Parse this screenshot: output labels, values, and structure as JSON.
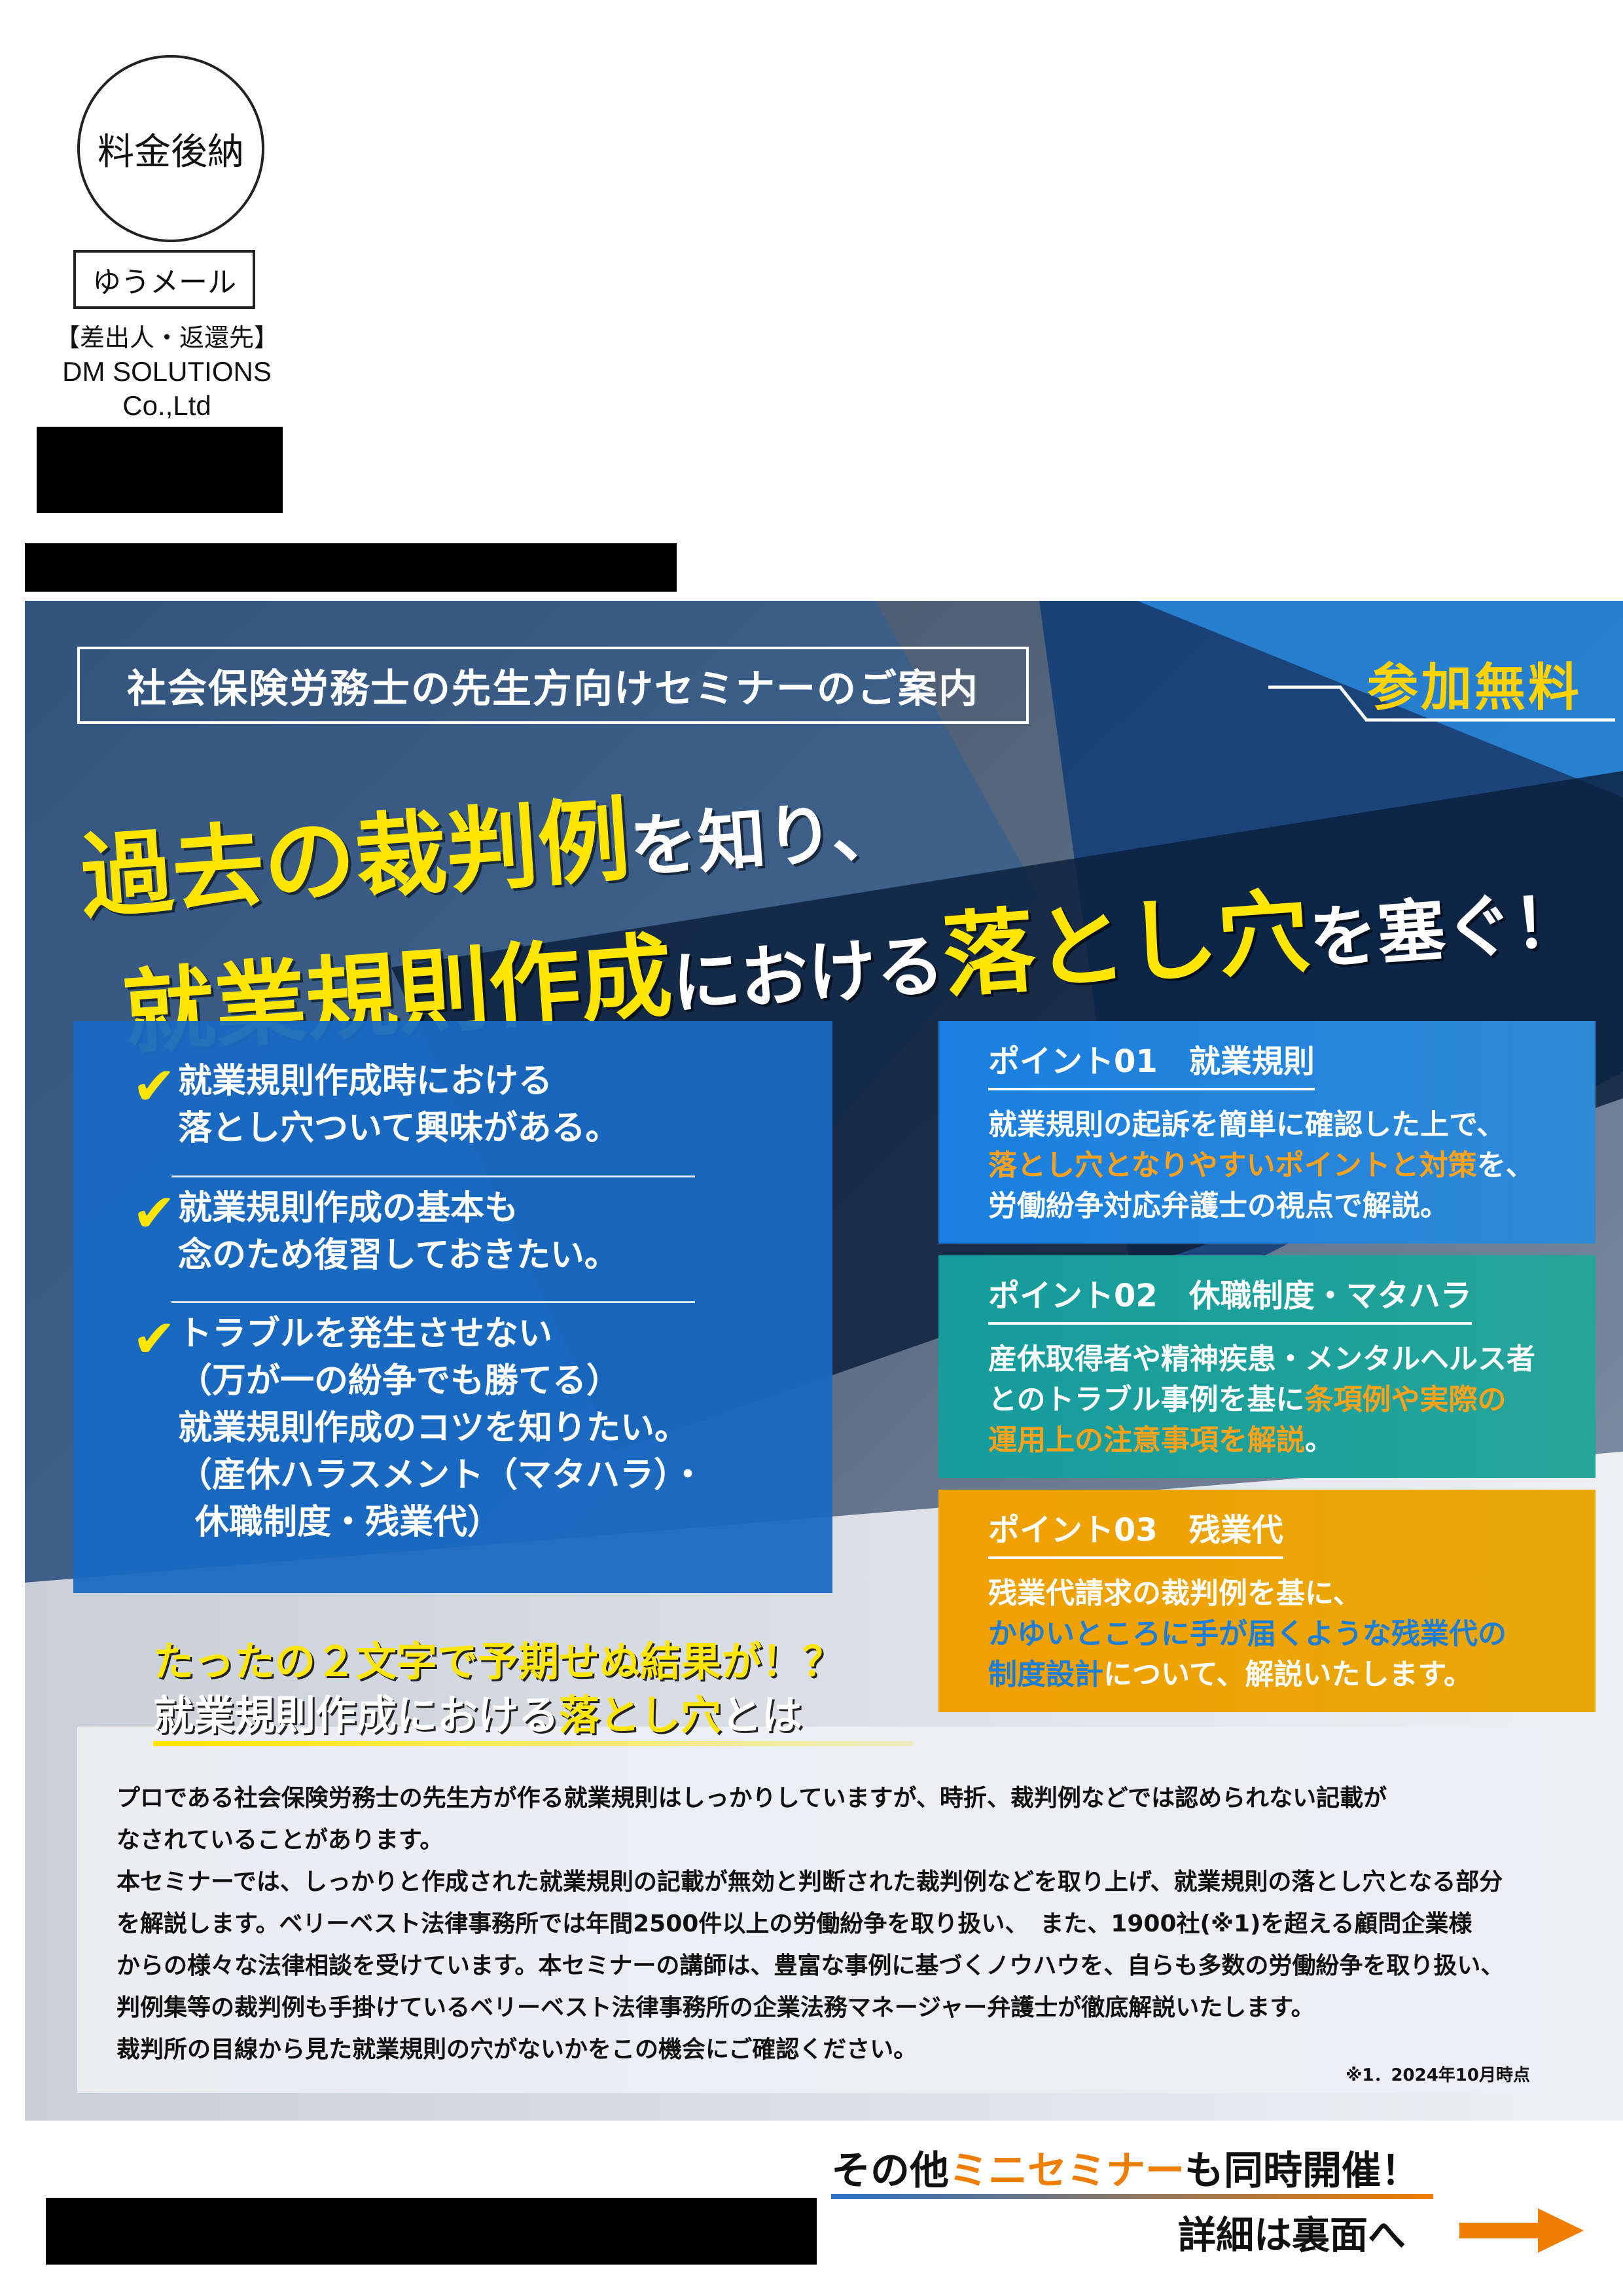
{
  "postage": {
    "stamp": "料金後納",
    "service": "ゆうメール"
  },
  "sender": {
    "label": "【差出人・返還先】",
    "company_line1": "DM SOLUTIONS",
    "company_line2": "Co.,Ltd"
  },
  "flyer": {
    "invite": "社会保険労務士の先生方向けセミナーのご案内",
    "free": "参加無料",
    "headline": {
      "l1_big": "過去の裁判例",
      "l1_mid": "を知り、",
      "l2_big": "就業規則作成",
      "l2_mid": "における",
      "l2_big2": "落とし穴",
      "l2_mid2": "を塞ぐ！"
    },
    "checks": [
      {
        "l1": "就業規則作成時における",
        "l2": "落とし穴ついて興味がある。"
      },
      {
        "l1": "就業規則作成の基本も",
        "l2": "念のため復習しておきたい。"
      },
      {
        "l1": "トラブルを発生させない",
        "l2": "（万が一の紛争でも勝てる）",
        "l3": "就業規則作成のコツを知りたい。",
        "l4": "（産休ハラスメント（マタハラ）・",
        "l5": "休職制度・残業代）"
      }
    ],
    "check_mark": "✔",
    "points": [
      {
        "title": "ポイント01　就業規則",
        "t1": "就業規則の起訴を簡単に確認した上で、",
        "t2_hl": "落とし穴となりやすいポイントと対策",
        "t2_rest": "を、",
        "t3": "労働紛争対応弁護士の視点で解説。"
      },
      {
        "title": "ポイント02　休職制度・マタハラ",
        "t1": "産休取得者や精神疾患・メンタルヘルス者",
        "t2_pre": "とのトラブル事例を基に",
        "t2_hl": "条項例や実際の",
        "t3_hl": "運用上の注意事項を解説",
        "t3_rest": "。"
      },
      {
        "title": "ポイント03　残業代",
        "t1": "残業代請求の裁判例を基に、",
        "t2_hl": "かゆいところに手が届くような残業代の",
        "t3_hl": "制度設計",
        "t3_rest": "について、解説いたします。"
      }
    ],
    "teaser": {
      "a1": "たったの",
      "a2": "２文字",
      "a3": "で",
      "a4": "予期せぬ結果",
      "a5": "が！？",
      "b1": "就業規則作成における",
      "b2": "落とし穴",
      "b3": "とは"
    },
    "body": [
      "プロである社会保険労務士の先生方が作る就業規則はしっかりしていますが、時折、裁判例などでは認められない記載が",
      "なされていることがあります。",
      "本セミナーでは、しっかりと作成された就業規則の記載が無効と判断された裁判例などを取り上げ、就業規則の落とし穴となる部分",
      "を解説します。ベリーベスト法律事務所では年間2500件以上の労働紛争を取り扱い、　また、1900社(※1)を超える顧問企業様",
      "からの様々な法律相談を受けています。本セミナーの講師は、豊富な事例に基づくノウハウを、自らも多数の労働紛争を取り扱い、",
      "判例集等の裁判例も手掛けているベリーベスト法律事務所の企業法務マネージャー弁護士が徹底解説いたします。",
      "裁判所の目線から見た就業規則の穴がないかをこの機会にご確認ください。"
    ],
    "footnote": "※1．2024年10月時点"
  },
  "bottom": {
    "other_a": "その他",
    "other_b": "ミニセミナー",
    "other_c": "も同時開催！",
    "detail": "詳細は裏面へ"
  },
  "colors": {
    "accent_yellow": "#ffe600",
    "accent_orange": "#ef7d00",
    "panel_blue": "#1869c3",
    "point1": "#1a7fe0",
    "point2": "#149c9c",
    "point3": "#f0a000"
  }
}
